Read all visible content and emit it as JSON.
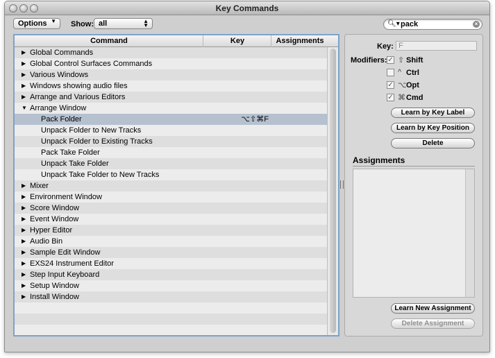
{
  "window": {
    "title": "Key Commands"
  },
  "toolbar": {
    "options_label": "Options",
    "show_label": "Show:",
    "show_value": "all",
    "search_value": "pack"
  },
  "table": {
    "columns": [
      "Command",
      "Key",
      "Assignments"
    ],
    "rows": [
      {
        "label": "Global Commands",
        "indent": 0,
        "expand": "collapsed",
        "key": ""
      },
      {
        "label": "Global Control Surfaces Commands",
        "indent": 0,
        "expand": "collapsed",
        "key": ""
      },
      {
        "label": "Various Windows",
        "indent": 0,
        "expand": "collapsed",
        "key": ""
      },
      {
        "label": "Windows showing audio files",
        "indent": 0,
        "expand": "collapsed",
        "key": ""
      },
      {
        "label": "Arrange and Various Editors",
        "indent": 0,
        "expand": "collapsed",
        "key": ""
      },
      {
        "label": "Arrange Window",
        "indent": 0,
        "expand": "expanded",
        "key": ""
      },
      {
        "label": "Pack Folder",
        "indent": 1,
        "expand": "none",
        "key": "⌥⇧⌘F",
        "selected": true
      },
      {
        "label": "Unpack Folder to New Tracks",
        "indent": 1,
        "expand": "none",
        "key": ""
      },
      {
        "label": "Unpack Folder to Existing Tracks",
        "indent": 1,
        "expand": "none",
        "key": ""
      },
      {
        "label": "Pack Take Folder",
        "indent": 1,
        "expand": "none",
        "key": ""
      },
      {
        "label": "Unpack Take Folder",
        "indent": 1,
        "expand": "none",
        "key": ""
      },
      {
        "label": "Unpack Take Folder to New Tracks",
        "indent": 1,
        "expand": "none",
        "key": ""
      },
      {
        "label": "Mixer",
        "indent": 0,
        "expand": "collapsed",
        "key": ""
      },
      {
        "label": "Environment Window",
        "indent": 0,
        "expand": "collapsed",
        "key": ""
      },
      {
        "label": "Score Window",
        "indent": 0,
        "expand": "collapsed",
        "key": ""
      },
      {
        "label": "Event Window",
        "indent": 0,
        "expand": "collapsed",
        "key": ""
      },
      {
        "label": "Hyper Editor",
        "indent": 0,
        "expand": "collapsed",
        "key": ""
      },
      {
        "label": "Audio Bin",
        "indent": 0,
        "expand": "collapsed",
        "key": ""
      },
      {
        "label": "Sample Edit Window",
        "indent": 0,
        "expand": "collapsed",
        "key": ""
      },
      {
        "label": "EXS24 Instrument Editor",
        "indent": 0,
        "expand": "collapsed",
        "key": ""
      },
      {
        "label": "Step Input Keyboard",
        "indent": 0,
        "expand": "collapsed",
        "key": ""
      },
      {
        "label": "Setup Window",
        "indent": 0,
        "expand": "collapsed",
        "key": ""
      },
      {
        "label": "Install Window",
        "indent": 0,
        "expand": "collapsed",
        "key": ""
      }
    ]
  },
  "panel": {
    "key_label": "Key:",
    "key_value": "F",
    "modifiers_label": "Modifiers:",
    "modifiers": [
      {
        "symbol": "⇧",
        "name": "Shift",
        "checked": true
      },
      {
        "symbol": "^",
        "name": "Ctrl",
        "checked": false
      },
      {
        "symbol": "⌥",
        "name": "Opt",
        "checked": true
      },
      {
        "symbol": "⌘",
        "name": "Cmd",
        "checked": true
      }
    ],
    "learn_by_label": "Learn by Key Label",
    "learn_by_position": "Learn by Key Position",
    "delete": "Delete",
    "assignments_title": "Assignments",
    "learn_new_assignment": "Learn New Assignment",
    "delete_assignment": "Delete Assignment"
  }
}
